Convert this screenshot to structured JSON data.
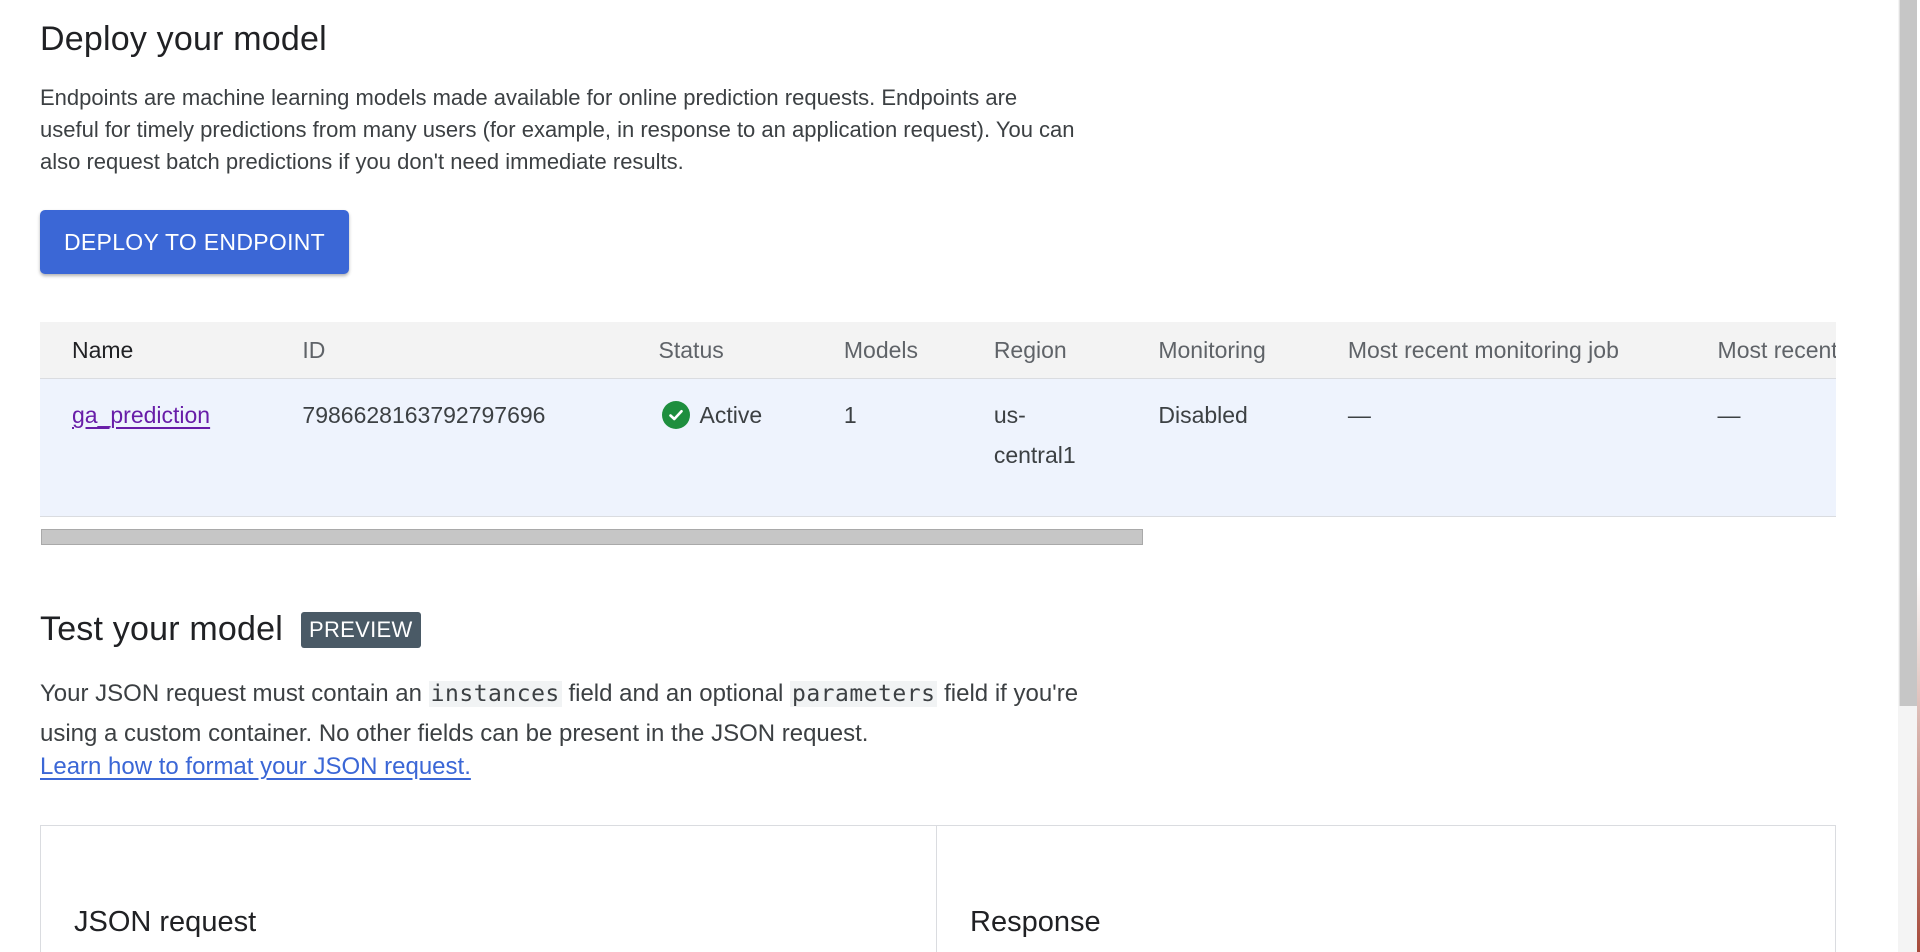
{
  "deploy": {
    "title": "Deploy your model",
    "description": "Endpoints are machine learning models made available for online prediction requests. Endpoints are useful for timely predictions from many users (for example, in response to an application request). You can also request batch predictions if you don't need immediate results.",
    "button_label": "DEPLOY TO ENDPOINT"
  },
  "table": {
    "headers": {
      "name": "Name",
      "id": "ID",
      "status": "Status",
      "models": "Models",
      "region": "Region",
      "monitoring": "Monitoring",
      "recent_job": "Most recent monitoring job",
      "alerts": "Most recent alerts"
    },
    "rows": [
      {
        "name": "ga_prediction",
        "id": "7986628163792797696",
        "status": "Active",
        "status_icon": "check-circle-icon",
        "models": "1",
        "region": "us-central1",
        "monitoring": "Disabled",
        "recent_job": "—",
        "alerts": "—"
      }
    ]
  },
  "test": {
    "title": "Test your model",
    "badge": "PREVIEW",
    "desc_part1": "Your JSON request must contain an",
    "code1": "instances",
    "desc_part2": "field and an optional",
    "code2": "parameters",
    "desc_part3": "field if you're using a custom container. No other fields can be present in the JSON request.",
    "learn_link": "Learn how to format your JSON request.",
    "request_panel_title": "JSON request",
    "response_panel_title": "Response"
  },
  "colors": {
    "primary_button": "#3b67d6",
    "link_visited": "#681da8",
    "status_active": "#1e8e3e",
    "row_selected_bg": "#eef3fd",
    "badge_bg": "#4a5a66"
  }
}
